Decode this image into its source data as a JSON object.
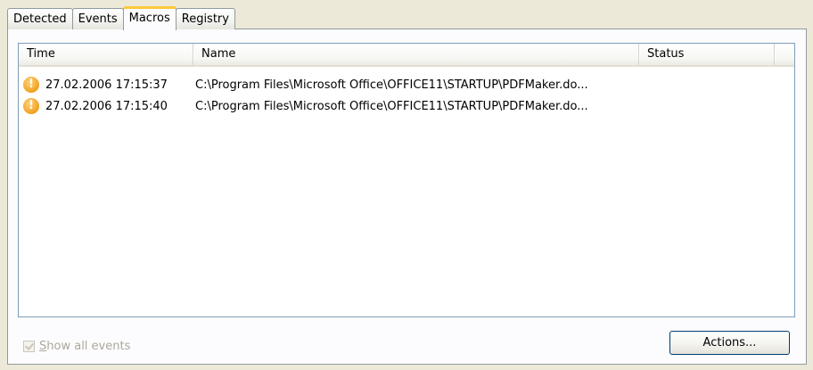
{
  "tabs": [
    {
      "label": "Detected",
      "active": false
    },
    {
      "label": "Events",
      "active": false
    },
    {
      "label": "Macros",
      "active": true
    },
    {
      "label": "Registry",
      "active": false
    }
  ],
  "list": {
    "columns": [
      "Time",
      "Name",
      "Status"
    ],
    "rows": [
      {
        "icon": "warning-icon",
        "time": "27.02.2006 17:15:37",
        "name": "C:\\Program Files\\Microsoft Office\\OFFICE11\\STARTUP\\PDFMaker.do...",
        "status": ""
      },
      {
        "icon": "warning-icon",
        "time": "27.02.2006 17:15:40",
        "name": "C:\\Program Files\\Microsoft Office\\OFFICE11\\STARTUP\\PDFMaker.do...",
        "status": ""
      }
    ]
  },
  "show_all_events": {
    "label_first": "S",
    "label_rest": "how all events",
    "checked": true,
    "disabled": true
  },
  "actions_button": {
    "label": "Actions..."
  },
  "colors": {
    "background": "#ece9d8",
    "active_tab_accent": "#ffc83c",
    "warning_icon": "#f0a020",
    "disabled_text": "#aca899"
  }
}
